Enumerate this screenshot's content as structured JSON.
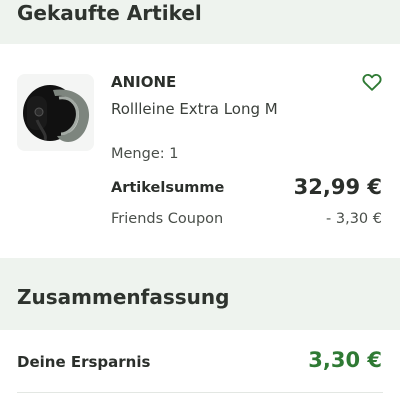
{
  "sections": {
    "purchased_items_title": "Gekaufte Artikel",
    "summary_title": "Zusammenfassung"
  },
  "item": {
    "brand": "ANIONE",
    "name": "Rollleine Extra Long M",
    "quantity_text": "Menge: 1",
    "subtotal_label": "Artikelsumme",
    "subtotal_value": "32,99 €",
    "coupon_label": "Friends Coupon",
    "coupon_value": "- 3,30 €",
    "favorite_icon": "heart-outline-icon",
    "image_description_icon": "retractable-leash-image"
  },
  "summary": {
    "savings_label": "Deine Ersparnis",
    "savings_value": "3,30 €"
  },
  "colors": {
    "background": "#eef3ee",
    "card": "#ffffff",
    "accent_green": "#2f7a34",
    "text_dark": "#2b2f2b"
  }
}
